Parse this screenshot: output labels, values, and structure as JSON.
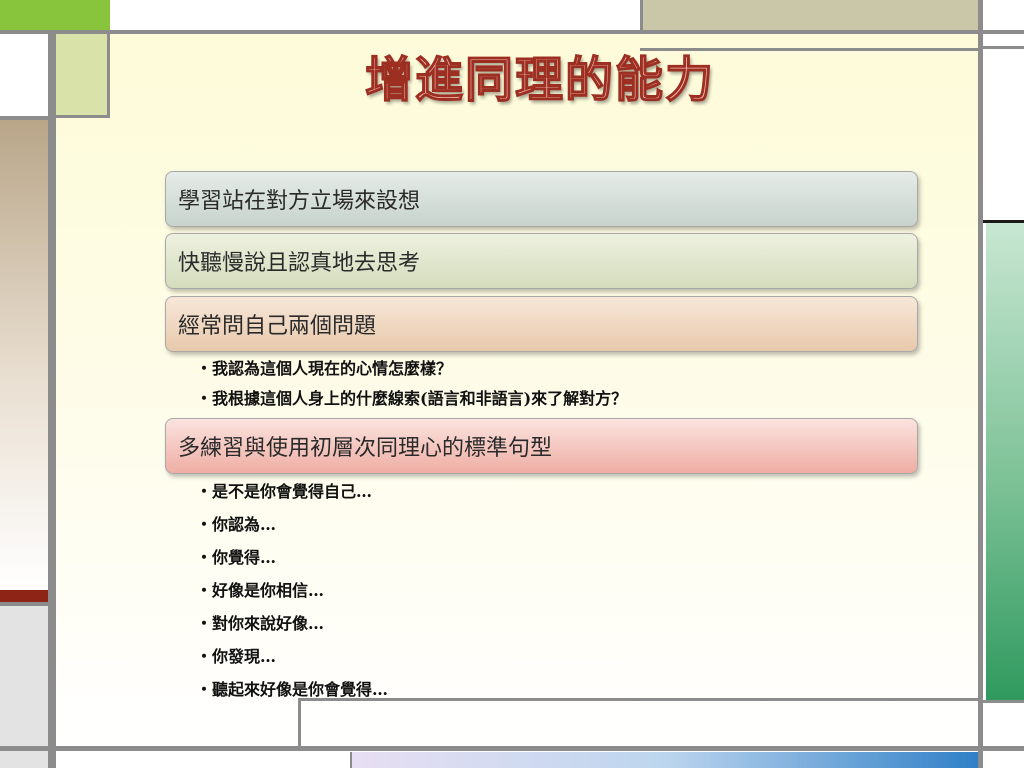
{
  "slide": {
    "title": "增進同理的能力",
    "boxes": [
      "學習站在對方立場來設想",
      "快聽慢說且認真地去思考",
      "經常問自己兩個問題",
      "多練習與使用初層次同理心的標準句型"
    ],
    "questions": [
      "我認為這個人現在的心情怎麼樣？",
      "我根據這個人身上的什麼線索(語言和非語言)來了解對方？"
    ],
    "sentence_patterns": [
      "是不是你會覺得自己…",
      "你認為…",
      "你覺得…",
      "好像是你相信…",
      "對你來說好像…",
      "你發現…",
      "聽起來好像是你會覺得…"
    ]
  },
  "colors": {
    "title_fill": "#f7b9b0",
    "title_outline": "#9c2f22",
    "accent_green": "#88c43c",
    "accent_red": "#8e2416"
  }
}
